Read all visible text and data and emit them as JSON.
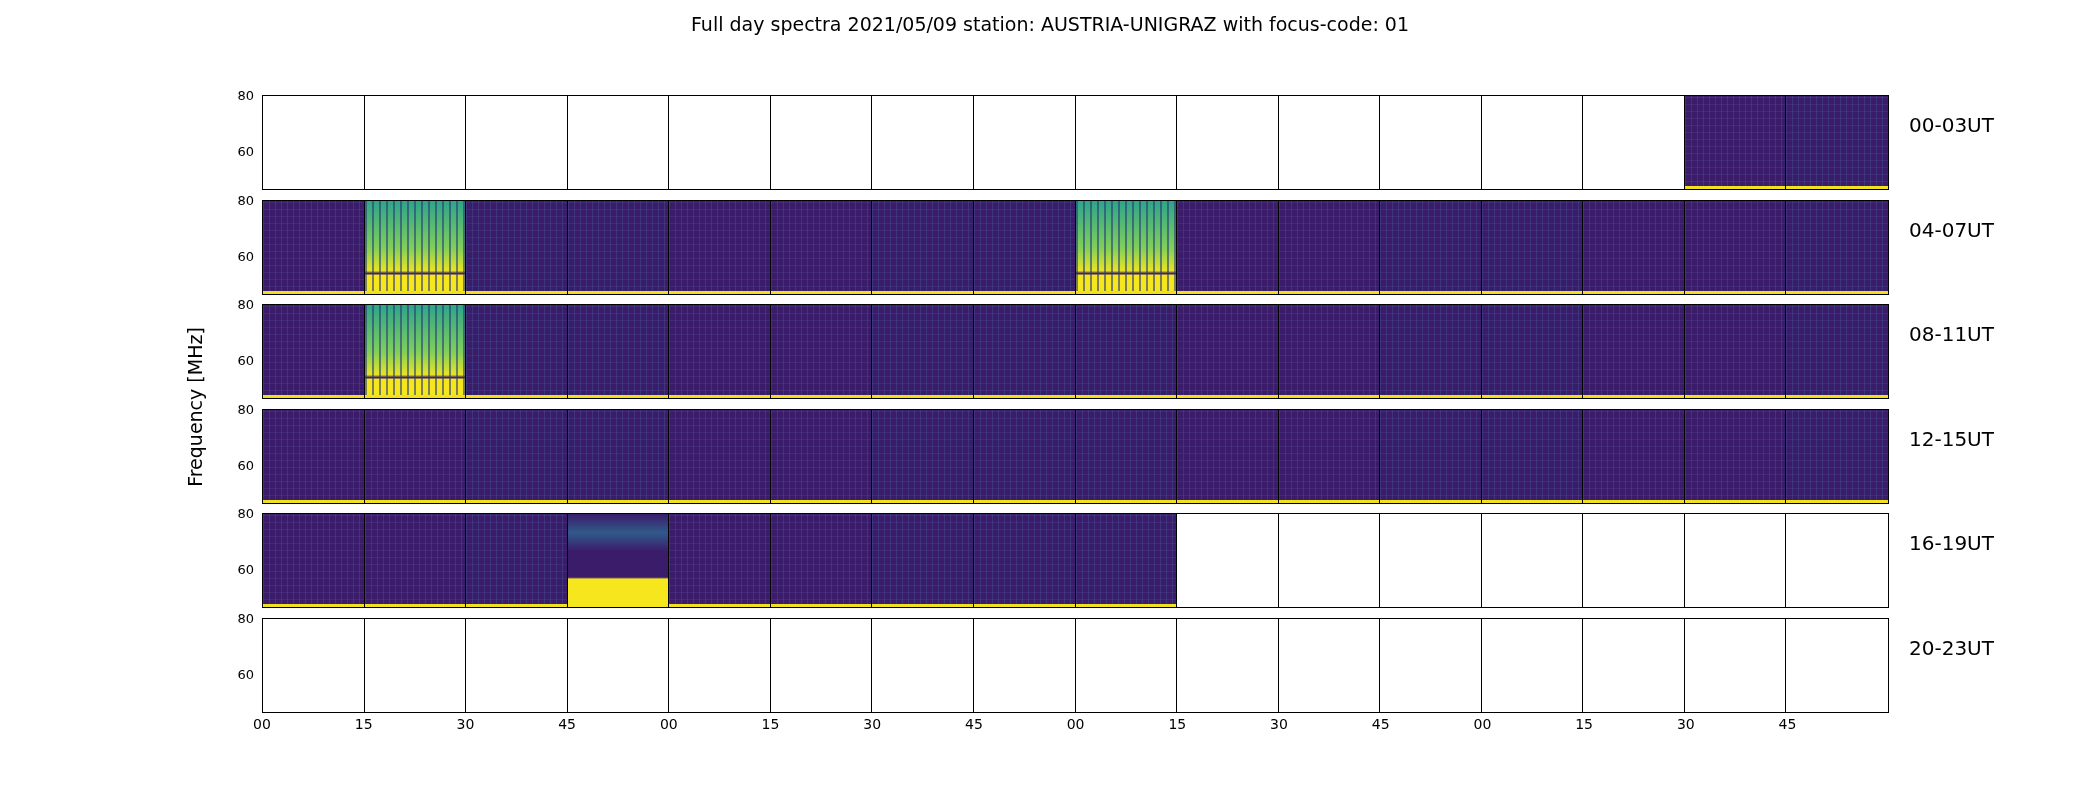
{
  "title": "Full day spectra 2021/05/09 station: AUSTRIA-UNIGRAZ with focus-code: 01",
  "ylabel": "Frequency [MHz]",
  "rows": [
    {
      "label": "00-03UT",
      "yticks": [
        "80",
        "60"
      ],
      "panels": [
        {
          "kind": "empty"
        },
        {
          "kind": "empty"
        },
        {
          "kind": "empty"
        },
        {
          "kind": "empty"
        },
        {
          "kind": "empty"
        },
        {
          "kind": "empty"
        },
        {
          "kind": "empty"
        },
        {
          "kind": "empty"
        },
        {
          "kind": "empty"
        },
        {
          "kind": "empty"
        },
        {
          "kind": "empty"
        },
        {
          "kind": "empty"
        },
        {
          "kind": "empty"
        },
        {
          "kind": "empty"
        },
        {
          "kind": "data"
        },
        {
          "kind": "data"
        }
      ]
    },
    {
      "label": "04-07UT",
      "yticks": [
        "80",
        "60"
      ],
      "panels": [
        {
          "kind": "data"
        },
        {
          "kind": "bright"
        },
        {
          "kind": "data"
        },
        {
          "kind": "data"
        },
        {
          "kind": "data"
        },
        {
          "kind": "data"
        },
        {
          "kind": "data"
        },
        {
          "kind": "data"
        },
        {
          "kind": "bright"
        },
        {
          "kind": "data"
        },
        {
          "kind": "data"
        },
        {
          "kind": "data"
        },
        {
          "kind": "data"
        },
        {
          "kind": "data"
        },
        {
          "kind": "data"
        },
        {
          "kind": "data"
        }
      ]
    },
    {
      "label": "08-11UT",
      "yticks": [
        "80",
        "60"
      ],
      "panels": [
        {
          "kind": "data"
        },
        {
          "kind": "bright"
        },
        {
          "kind": "data"
        },
        {
          "kind": "data"
        },
        {
          "kind": "data"
        },
        {
          "kind": "data"
        },
        {
          "kind": "data"
        },
        {
          "kind": "data"
        },
        {
          "kind": "data"
        },
        {
          "kind": "data"
        },
        {
          "kind": "data"
        },
        {
          "kind": "data"
        },
        {
          "kind": "data"
        },
        {
          "kind": "data"
        },
        {
          "kind": "data"
        },
        {
          "kind": "data"
        }
      ]
    },
    {
      "label": "12-15UT",
      "yticks": [
        "80",
        "60"
      ],
      "panels": [
        {
          "kind": "data"
        },
        {
          "kind": "data"
        },
        {
          "kind": "data"
        },
        {
          "kind": "data"
        },
        {
          "kind": "data"
        },
        {
          "kind": "data"
        },
        {
          "kind": "data"
        },
        {
          "kind": "data"
        },
        {
          "kind": "data"
        },
        {
          "kind": "data"
        },
        {
          "kind": "data"
        },
        {
          "kind": "data"
        },
        {
          "kind": "data"
        },
        {
          "kind": "data"
        },
        {
          "kind": "data"
        },
        {
          "kind": "data"
        }
      ]
    },
    {
      "label": "16-19UT",
      "yticks": [
        "80",
        "60"
      ],
      "panels": [
        {
          "kind": "data"
        },
        {
          "kind": "data"
        },
        {
          "kind": "data"
        },
        {
          "kind": "band"
        },
        {
          "kind": "data"
        },
        {
          "kind": "data"
        },
        {
          "kind": "data"
        },
        {
          "kind": "data"
        },
        {
          "kind": "data"
        },
        {
          "kind": "empty"
        },
        {
          "kind": "empty"
        },
        {
          "kind": "empty"
        },
        {
          "kind": "empty"
        },
        {
          "kind": "empty"
        },
        {
          "kind": "empty"
        },
        {
          "kind": "empty"
        }
      ]
    },
    {
      "label": "20-23UT",
      "yticks": [
        "80",
        "60"
      ],
      "panels": [
        {
          "kind": "empty"
        },
        {
          "kind": "empty"
        },
        {
          "kind": "empty"
        },
        {
          "kind": "empty"
        },
        {
          "kind": "empty"
        },
        {
          "kind": "empty"
        },
        {
          "kind": "empty"
        },
        {
          "kind": "empty"
        },
        {
          "kind": "empty"
        },
        {
          "kind": "empty"
        },
        {
          "kind": "empty"
        },
        {
          "kind": "empty"
        },
        {
          "kind": "empty"
        },
        {
          "kind": "empty"
        },
        {
          "kind": "empty"
        },
        {
          "kind": "empty"
        }
      ]
    }
  ],
  "xticks": [
    "00",
    "15",
    "30",
    "45",
    "00",
    "15",
    "30",
    "45",
    "00",
    "15",
    "30",
    "45",
    "00",
    "15",
    "30",
    "45"
  ]
}
